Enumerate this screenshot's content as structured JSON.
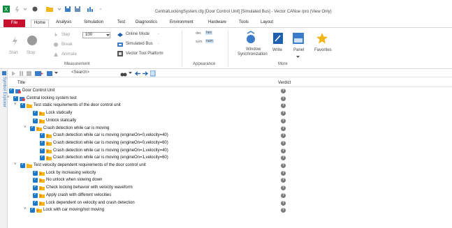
{
  "window": {
    "title": "CentralLockingSystem.cfg [Door Control Unit] [Simulated Bus] - Vector CANoe /pro (View Only)"
  },
  "ribbon_tabs": [
    "File",
    "Home",
    "Analysis",
    "Simulation",
    "Test",
    "Diagnostics",
    "Environment",
    "Hardware",
    "Tools",
    "Layout"
  ],
  "active_tab": "Home",
  "ribbon": {
    "start_label": "Start",
    "stop_label": "Stop",
    "step_label": "Step",
    "break_label": "Break",
    "animate_label": "Animate",
    "speed_value": "100",
    "online_mode_label": "Online Mode",
    "simulated_bus_label": "Simulated Bus",
    "vector_tool_platform_label": "Vector Tool Platform",
    "measurement_group": "Measurement",
    "appearance_group": "Appearance",
    "window_sync_label_1": "Window",
    "window_sync_label_2": "Synchronization",
    "write_label": "Write",
    "panel_label": "Panel",
    "favorites_label": "Favorites",
    "more_group": "More",
    "appearance_dec": "dec",
    "appearance_hex": "hex",
    "appearance_sym": "sym",
    "appearance_num": "num"
  },
  "toolbar": {
    "search_placeholder": "<Search>"
  },
  "side_strip_label": "Symbol Explorer",
  "table": {
    "col_title": "Title",
    "col_verdict": "Verdict",
    "rows": [
      {
        "label": "Door Control Unit"
      },
      {
        "label": "Central locking system test"
      },
      {
        "label": "Test static requirements of the door control unit"
      },
      {
        "label": "Lock statically"
      },
      {
        "label": "Unlock statically"
      },
      {
        "label": "Crash detection while car is moving"
      },
      {
        "label": "Crash detection while car is moving (engineOn=0,velocity=40)"
      },
      {
        "label": "Crash detection while car is moving (engineOn=0,velocity=60)"
      },
      {
        "label": "Crash detection while car is moving (engineOn=1,velocity=40)"
      },
      {
        "label": "Crash detection while car is moving (engineOn=1,velocity=60)"
      },
      {
        "label": "Test velocity dependent requirements of the door control unit"
      },
      {
        "label": "Lock by increasing velocity"
      },
      {
        "label": "No unlock when slowing down"
      },
      {
        "label": "Check locking behavior with velocity waveform"
      },
      {
        "label": "Apply crash with different velocities"
      },
      {
        "label": "Lock dependent on velocity and crash detection"
      },
      {
        "label": "Lock with car moving/not moving"
      }
    ],
    "verdict_symbol": "?"
  },
  "colors": {
    "file_tab": "#c8102e",
    "checkbox": "#1e78c8",
    "folder": "#f2b61b",
    "verdict": "#7a7a7a"
  }
}
